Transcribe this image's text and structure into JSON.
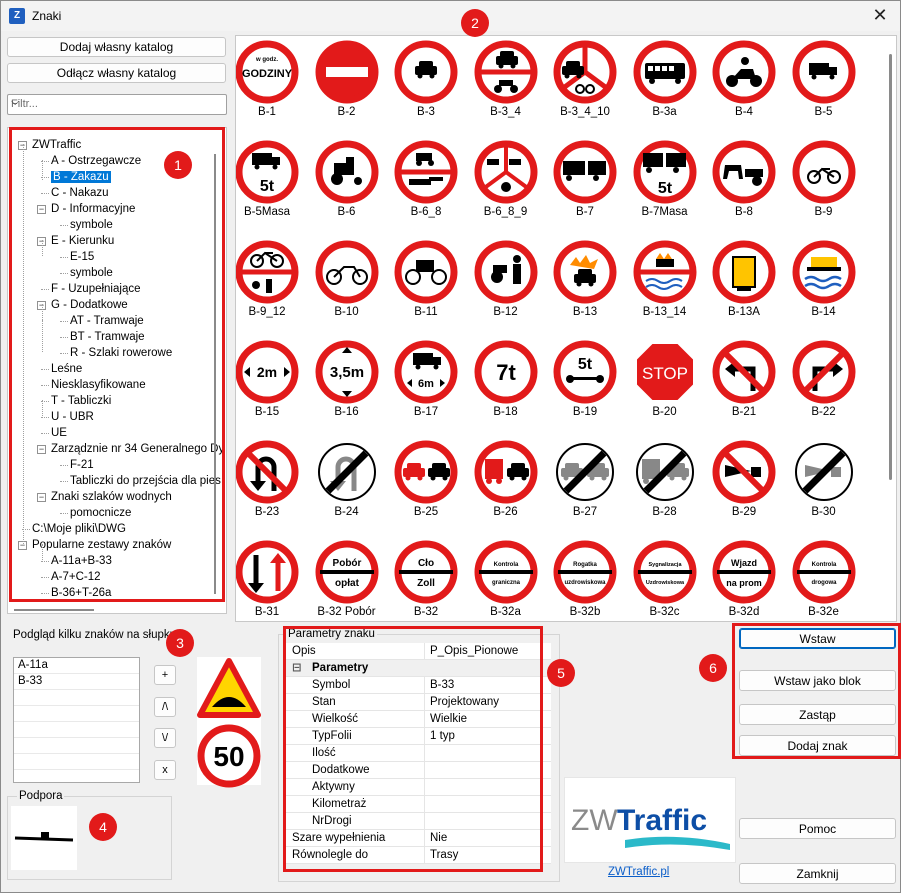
{
  "window": {
    "title": "Znaki",
    "close": "✕"
  },
  "buttons": {
    "add_catalog": "Dodaj własny katalog",
    "detach_catalog": "Odłącz własny katalog",
    "insert": "Wstaw",
    "insert_block": "Wstaw jako blok",
    "replace": "Zastąp",
    "add_sign": "Dodaj znak",
    "help": "Pomoc",
    "close": "Zamknij"
  },
  "filter": {
    "placeholder": "Filtr..."
  },
  "tree": [
    "ZWTraffic",
    "A - Ostrzegawcze",
    "B - Zakazu",
    "C - Nakazu",
    "D - Informacyjne",
    "symbole",
    "E - Kierunku",
    "E-15",
    "symbole",
    "F - Uzupełniające",
    "G - Dodatkowe",
    "AT - Tramwaje",
    "BT - Tramwaje",
    "R - Szlaki rowerowe",
    "Leśne",
    "Niesklasyfikowane",
    "T - Tabliczki",
    "U - UBR",
    "UE",
    "Zarządznie nr 34 Generalnego Dy",
    "F-21",
    "Tabliczki do przejścia dla pies",
    "Znaki szlaków wodnych",
    "pomocnicze",
    "C:\\Moje pliki\\DWG",
    "Popularne zestawy znaków",
    "A-11a+B-33",
    "A-7+C-12",
    "B-36+T-26a"
  ],
  "signs": [
    "B-1",
    "B-2",
    "B-3",
    "B-3_4",
    "B-3_4_10",
    "B-3a",
    "B-4",
    "B-5",
    "B-5Masa",
    "B-6",
    "B-6_8",
    "B-6_8_9",
    "B-7",
    "B-7Masa",
    "B-8",
    "B-9",
    "B-9_12",
    "B-10",
    "B-11",
    "B-12",
    "B-13",
    "B-13_14",
    "B-13A",
    "B-14",
    "B-15",
    "B-16",
    "B-17",
    "B-18",
    "B-19",
    "B-20",
    "B-21",
    "B-22",
    "B-23",
    "B-24",
    "B-25",
    "B-26",
    "B-27",
    "B-28",
    "B-29",
    "B-30",
    "B-31",
    "B-32 Pobór",
    "B-32",
    "B-32a",
    "B-32b",
    "B-32c",
    "B-32d",
    "B-32e"
  ],
  "sign_texts": {
    "b1_top": "w godz.",
    "b1_main": "GODZINY",
    "b5masa": "5t",
    "b7masa": "5t",
    "b15": "2m",
    "b16": "3,5m",
    "b17": "6m",
    "b18": "7t",
    "b19": "5t",
    "b20": "STOP",
    "b32pobor_a": "Pobór",
    "b32pobor_b": "opłat",
    "b32_a": "Cło",
    "b32_b": "Zoll",
    "b32a_a": "Kontrola",
    "b32a_b": "graniczna",
    "b32b_a": "Rogatka",
    "b32b_b": "uzdrowiskowa",
    "b32c_a": "Sygnalizacja",
    "b32c_b": "Uzdrowiskowa",
    "b32d_a": "Wjazd",
    "b32d_b": "na prom",
    "b32e_a": "Kontrola",
    "b32e_b": "drogowa"
  },
  "preview": {
    "group_title": "Podgląd kilku znaków na słupku",
    "items": [
      "A-11a",
      "B-33"
    ],
    "controls": [
      "+",
      "/\\",
      "\\/",
      "x"
    ],
    "speed_limit": "50"
  },
  "support": {
    "group_title": "Podpora"
  },
  "params": {
    "group_title": "Parametry znaku",
    "rows": [
      {
        "key": "Opis",
        "value": "P_Opis_Pionowe"
      },
      {
        "key": "Parametry",
        "value": "",
        "category": true,
        "toggle": "⊟"
      },
      {
        "key": "Symbol",
        "value": "B-33"
      },
      {
        "key": "Stan",
        "value": "Projektowany"
      },
      {
        "key": "Wielkość",
        "value": "Wielkie"
      },
      {
        "key": "TypFolii",
        "value": "1 typ"
      },
      {
        "key": "Ilość",
        "value": ""
      },
      {
        "key": "Dodatkowe",
        "value": ""
      },
      {
        "key": "Aktywny",
        "value": ""
      },
      {
        "key": "Kilometraż",
        "value": ""
      },
      {
        "key": "NrDrogi",
        "value": ""
      },
      {
        "key": "Szare wypełnienia",
        "value": "Nie"
      },
      {
        "key": "Równolegle do",
        "value": "Trasy"
      }
    ]
  },
  "logo": {
    "zw": "ZW",
    "traffic": "Traffic",
    "link": "ZWTraffic.pl"
  },
  "badges": [
    "1",
    "2",
    "3",
    "4",
    "5",
    "6"
  ],
  "colors": {
    "sign_red": "#e21a1a",
    "selection": "#0078d7",
    "annotation_red": "#e21a1a"
  }
}
